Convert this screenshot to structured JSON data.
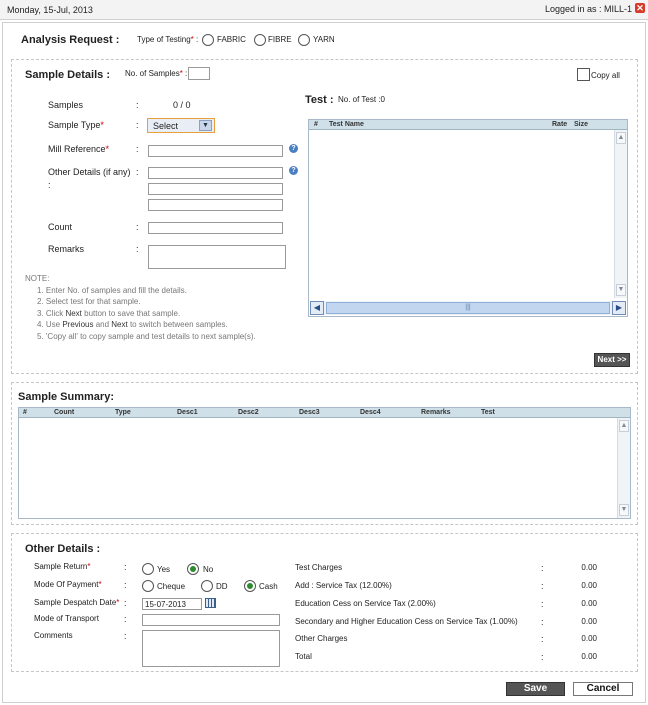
{
  "topbar": {
    "date": "Monday, 15-Jul, 2013",
    "logged_in": "Logged in as : MILL-1",
    "close_icon": "close-icon"
  },
  "analysis": {
    "title": "Analysis Request :",
    "type_label": "Type of Testing",
    "type_required": "*",
    "type_colon": " :",
    "options": [
      "FABRIC",
      "FIBRE",
      "YARN"
    ]
  },
  "sample_details": {
    "title": "Sample Details :",
    "num_samples_label": "No. of Samples",
    "num_samples_required": "*",
    "num_samples_colon": " :",
    "num_samples_value": "",
    "copy_all": "Copy all",
    "samples_label": "Samples",
    "samples_value": "0 / 0",
    "sample_type_label": "Sample Type",
    "sample_type_selected": "Select",
    "mill_ref_label": "Mill Reference",
    "other_details_label": "Other Details (if any)",
    "count_label": "Count",
    "remarks_label": "Remarks",
    "colon": ":",
    "required": "*",
    "note_title": "NOTE:",
    "notes": [
      "1. Enter No. of samples and fill the details.",
      "2. Select test for that sample.",
      "3. Click ",
      "Next",
      " button to save that sample.",
      "4. Use ",
      "Previous",
      " and ",
      "Next",
      " to switch between samples.",
      "5. 'Copy all' to copy sample and test details to next sample(s)."
    ],
    "next_button": "Next >>"
  },
  "test": {
    "title": "Test :",
    "count_label": "No. of Test :0",
    "columns": [
      "#",
      "Test Name",
      "Rate",
      "Size"
    ]
  },
  "summary": {
    "title": "Sample Summary:",
    "columns": [
      "#",
      "Count",
      "Type",
      "Desc1",
      "Desc2",
      "Desc3",
      "Desc4",
      "Remarks",
      "Test"
    ]
  },
  "other": {
    "title": "Other Details :",
    "sample_return_label": "Sample Return",
    "yes": "Yes",
    "no": "No",
    "payment_label": "Mode Of Payment",
    "cheque": "Cheque",
    "dd": "DD",
    "cash": "Cash",
    "despatch_label": "Sample Despatch Date",
    "despatch_value": "15-07-2013",
    "transport_label": "Mode of Transport",
    "comments_label": "Comments",
    "colon": ":",
    "required": "*",
    "charges": [
      {
        "label": "Test Charges",
        "value": "0.00"
      },
      {
        "label": "Add : Service Tax (12.00%)",
        "value": "0.00"
      },
      {
        "label": "Education Cess on Service Tax (2.00%)",
        "value": "0.00"
      },
      {
        "label": "Secondary and Higher Education Cess on Service Tax (1.00%)",
        "value": "0.00"
      },
      {
        "label": "Other Charges",
        "value": "0.00"
      },
      {
        "label": "Total",
        "value": "0.00"
      }
    ]
  },
  "buttons": {
    "save": "Save",
    "cancel": "Cancel"
  }
}
